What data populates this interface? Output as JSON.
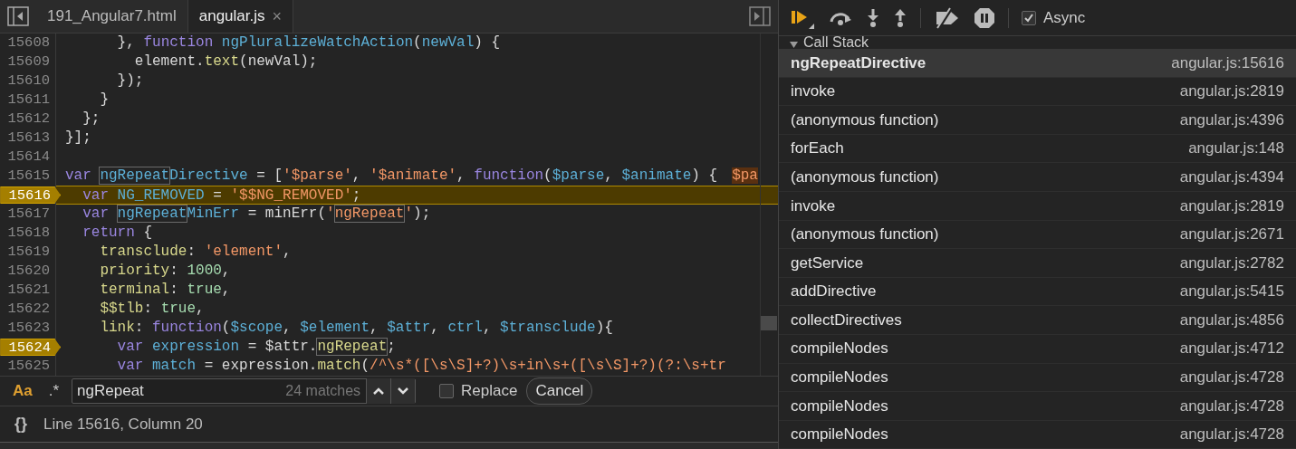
{
  "editor": {
    "tabs": [
      {
        "label": "191_Angular7.html",
        "selected": false,
        "closable": false
      },
      {
        "label": "angular.js",
        "selected": true,
        "closable": true,
        "close_glyph": "×"
      }
    ],
    "lines": [
      {
        "number": "15608",
        "current": false,
        "breakpoint": false,
        "tokens": [
          {
            "kind": "plain",
            "text": "      }, "
          },
          {
            "kind": "kw",
            "text": "function "
          },
          {
            "kind": "var",
            "text": "ngPluralizeWatchAction"
          },
          {
            "kind": "plain",
            "text": "("
          },
          {
            "kind": "var",
            "text": "newVal"
          },
          {
            "kind": "plain",
            "text": ") {"
          }
        ]
      },
      {
        "number": "15609",
        "current": false,
        "breakpoint": false,
        "tokens": [
          {
            "kind": "plain",
            "text": "        element."
          },
          {
            "kind": "prop",
            "text": "text"
          },
          {
            "kind": "plain",
            "text": "(newVal);"
          }
        ]
      },
      {
        "number": "15610",
        "current": false,
        "breakpoint": false,
        "tokens": [
          {
            "kind": "plain",
            "text": "      });"
          }
        ]
      },
      {
        "number": "15611",
        "current": false,
        "breakpoint": false,
        "tokens": [
          {
            "kind": "plain",
            "text": "    }"
          }
        ]
      },
      {
        "number": "15612",
        "current": false,
        "breakpoint": false,
        "tokens": [
          {
            "kind": "plain",
            "text": "  };"
          }
        ]
      },
      {
        "number": "15613",
        "current": false,
        "breakpoint": false,
        "tokens": [
          {
            "kind": "plain",
            "text": "}];"
          }
        ]
      },
      {
        "number": "15614",
        "current": false,
        "breakpoint": false
      },
      {
        "number": "15615",
        "current": false,
        "breakpoint": false,
        "inline_value": "$pa",
        "tokens": [
          {
            "kind": "kw",
            "text": "var "
          },
          {
            "kind": "var",
            "text": "ngRepeat",
            "match": true
          },
          {
            "kind": "var",
            "text": "Directive"
          },
          {
            "kind": "plain",
            "text": " = ["
          },
          {
            "kind": "str",
            "text": "'$parse'"
          },
          {
            "kind": "plain",
            "text": ", "
          },
          {
            "kind": "str",
            "text": "'$animate'"
          },
          {
            "kind": "plain",
            "text": ", "
          },
          {
            "kind": "kw",
            "text": "function"
          },
          {
            "kind": "plain",
            "text": "("
          },
          {
            "kind": "var",
            "text": "$parse"
          },
          {
            "kind": "plain",
            "text": ", "
          },
          {
            "kind": "var",
            "text": "$animate"
          },
          {
            "kind": "plain",
            "text": ") {"
          }
        ]
      },
      {
        "number": "15616",
        "current": true,
        "breakpoint": true,
        "tokens": [
          {
            "kind": "kw",
            "text": "  var "
          },
          {
            "kind": "var",
            "text": "NG_REMOVED"
          },
          {
            "kind": "plain",
            "text": " = "
          },
          {
            "kind": "str",
            "text": "'$$NG_REMOVED'"
          },
          {
            "kind": "plain",
            "text": ";"
          }
        ]
      },
      {
        "number": "15617",
        "current": false,
        "breakpoint": false,
        "tokens": [
          {
            "kind": "kw",
            "text": "  var "
          },
          {
            "kind": "var",
            "text": "ngRepeat",
            "match": true
          },
          {
            "kind": "var",
            "text": "MinErr"
          },
          {
            "kind": "plain",
            "text": " = minErr("
          },
          {
            "kind": "str",
            "text": "'"
          },
          {
            "kind": "str",
            "text": "ngRepeat",
            "match": true
          },
          {
            "kind": "str",
            "text": "'"
          },
          {
            "kind": "plain",
            "text": ");"
          }
        ]
      },
      {
        "number": "15618",
        "current": false,
        "breakpoint": false,
        "tokens": [
          {
            "kind": "kw",
            "text": "  return"
          },
          {
            "kind": "plain",
            "text": " {"
          }
        ]
      },
      {
        "number": "15619",
        "current": false,
        "breakpoint": false,
        "tokens": [
          {
            "kind": "prop",
            "text": "    transclude"
          },
          {
            "kind": "plain",
            "text": ": "
          },
          {
            "kind": "str",
            "text": "'element'"
          },
          {
            "kind": "plain",
            "text": ","
          }
        ]
      },
      {
        "number": "15620",
        "current": false,
        "breakpoint": false,
        "tokens": [
          {
            "kind": "prop",
            "text": "    priority"
          },
          {
            "kind": "plain",
            "text": ": "
          },
          {
            "kind": "num",
            "text": "1000"
          },
          {
            "kind": "plain",
            "text": ","
          }
        ]
      },
      {
        "number": "15621",
        "current": false,
        "breakpoint": false,
        "tokens": [
          {
            "kind": "prop",
            "text": "    terminal"
          },
          {
            "kind": "plain",
            "text": ": "
          },
          {
            "kind": "num",
            "text": "true"
          },
          {
            "kind": "plain",
            "text": ","
          }
        ]
      },
      {
        "number": "15622",
        "current": false,
        "breakpoint": false,
        "tokens": [
          {
            "kind": "prop",
            "text": "    $$tlb"
          },
          {
            "kind": "plain",
            "text": ": "
          },
          {
            "kind": "num",
            "text": "true"
          },
          {
            "kind": "plain",
            "text": ","
          }
        ]
      },
      {
        "number": "15623",
        "current": false,
        "breakpoint": false,
        "tokens": [
          {
            "kind": "prop",
            "text": "    link"
          },
          {
            "kind": "plain",
            "text": ": "
          },
          {
            "kind": "kw",
            "text": "function"
          },
          {
            "kind": "plain",
            "text": "("
          },
          {
            "kind": "var",
            "text": "$scope"
          },
          {
            "kind": "plain",
            "text": ", "
          },
          {
            "kind": "var",
            "text": "$element"
          },
          {
            "kind": "plain",
            "text": ", "
          },
          {
            "kind": "var",
            "text": "$attr"
          },
          {
            "kind": "plain",
            "text": ", "
          },
          {
            "kind": "var",
            "text": "ctrl"
          },
          {
            "kind": "plain",
            "text": ", "
          },
          {
            "kind": "var",
            "text": "$transclude"
          },
          {
            "kind": "plain",
            "text": "){"
          }
        ]
      },
      {
        "number": "15624",
        "current": false,
        "breakpoint": true,
        "tokens": [
          {
            "kind": "kw",
            "text": "      var "
          },
          {
            "kind": "var",
            "text": "expression"
          },
          {
            "kind": "plain",
            "text": " = $attr."
          },
          {
            "kind": "prop",
            "text": "ngRepeat",
            "match": true
          },
          {
            "kind": "plain",
            "text": ";"
          }
        ]
      },
      {
        "number": "15625",
        "current": false,
        "breakpoint": false,
        "tokens": [
          {
            "kind": "kw",
            "text": "      var "
          },
          {
            "kind": "var",
            "text": "match"
          },
          {
            "kind": "plain",
            "text": " = expression."
          },
          {
            "kind": "prop",
            "text": "match"
          },
          {
            "kind": "plain",
            "text": "("
          },
          {
            "kind": "str",
            "text": "/^\\s*([\\s\\S]+?)\\s+in\\s+([\\s\\S]+?)(?:\\s+tr"
          }
        ]
      }
    ]
  },
  "search": {
    "case_toggle": {
      "label": "Aa",
      "selected": true
    },
    "regex_toggle": {
      "label": ".*",
      "selected": false
    },
    "value": "ngRepeat",
    "matches": "24 matches",
    "replace": {
      "label": "Replace",
      "checked": false
    },
    "cancel": "Cancel"
  },
  "status_bar": {
    "pretty_print": "{}",
    "position": "Line 15616, Column 20"
  },
  "debugger": {
    "async": {
      "label": "Async",
      "checked": true
    },
    "call_stack_title": "Call Stack",
    "frames": [
      {
        "name": "ngRepeatDirective",
        "location": "angular.js:15616",
        "selected": true
      },
      {
        "name": "invoke",
        "location": "angular.js:2819",
        "selected": false
      },
      {
        "name": "(anonymous function)",
        "location": "angular.js:4396",
        "selected": false
      },
      {
        "name": "forEach",
        "location": "angular.js:148",
        "selected": false
      },
      {
        "name": "(anonymous function)",
        "location": "angular.js:4394",
        "selected": false
      },
      {
        "name": "invoke",
        "location": "angular.js:2819",
        "selected": false
      },
      {
        "name": "(anonymous function)",
        "location": "angular.js:2671",
        "selected": false
      },
      {
        "name": "getService",
        "location": "angular.js:2782",
        "selected": false
      },
      {
        "name": "addDirective",
        "location": "angular.js:5415",
        "selected": false
      },
      {
        "name": "collectDirectives",
        "location": "angular.js:4856",
        "selected": false
      },
      {
        "name": "compileNodes",
        "location": "angular.js:4712",
        "selected": false
      },
      {
        "name": "compileNodes",
        "location": "angular.js:4728",
        "selected": false
      },
      {
        "name": "compileNodes",
        "location": "angular.js:4728",
        "selected": false
      },
      {
        "name": "compileNodes",
        "location": "angular.js:4728",
        "selected": false
      }
    ]
  }
}
